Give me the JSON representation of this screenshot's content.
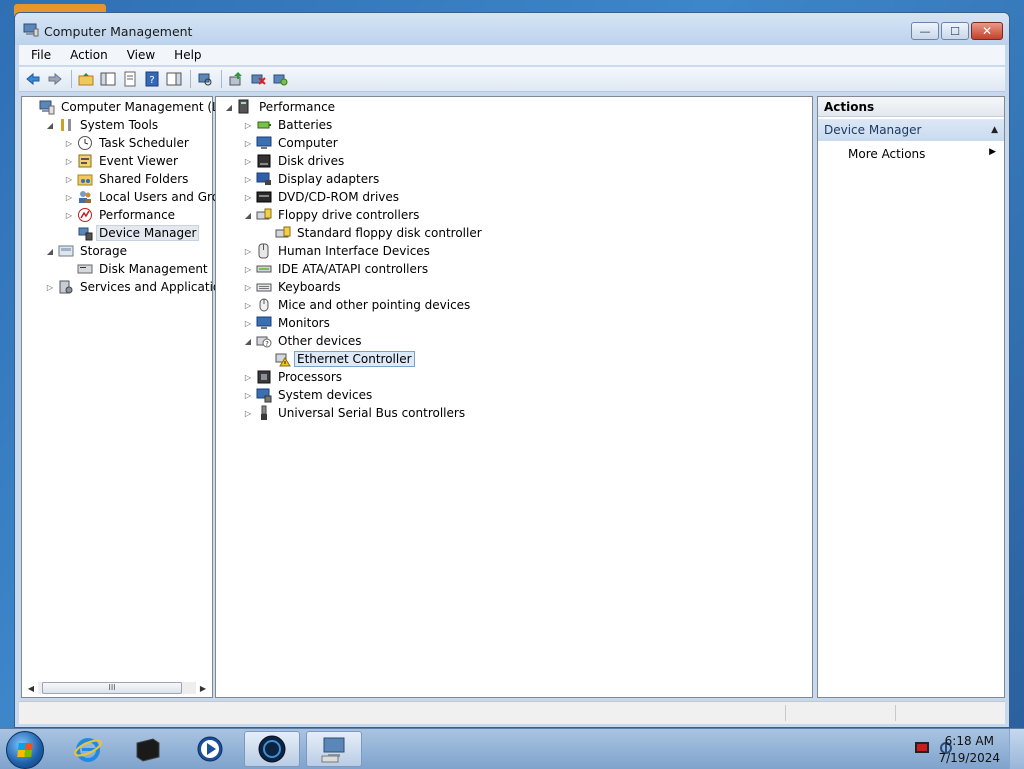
{
  "window": {
    "title": "Computer Management"
  },
  "caption": {
    "minimize": "—",
    "maximize": "☐",
    "close": "✕"
  },
  "menu": [
    "File",
    "Action",
    "View",
    "Help"
  ],
  "left_tree": [
    {
      "label": "Computer Management (Local",
      "icon": "computer-management-icon",
      "level": 0,
      "expander": "none"
    },
    {
      "label": "System Tools",
      "icon": "tools-icon",
      "level": 1,
      "expander": "expanded"
    },
    {
      "label": "Task Scheduler",
      "icon": "clock-icon",
      "level": 2,
      "expander": "collapsed"
    },
    {
      "label": "Event Viewer",
      "icon": "event-viewer-icon",
      "level": 2,
      "expander": "collapsed"
    },
    {
      "label": "Shared Folders",
      "icon": "shared-folder-icon",
      "level": 2,
      "expander": "collapsed"
    },
    {
      "label": "Local Users and Groups",
      "icon": "users-icon",
      "level": 2,
      "expander": "collapsed"
    },
    {
      "label": "Performance",
      "icon": "performance-icon",
      "level": 2,
      "expander": "collapsed"
    },
    {
      "label": "Device Manager",
      "icon": "device-manager-icon",
      "level": 2,
      "expander": "none",
      "selected": true
    },
    {
      "label": "Storage",
      "icon": "storage-icon",
      "level": 1,
      "expander": "expanded"
    },
    {
      "label": "Disk Management",
      "icon": "disk-icon",
      "level": 2,
      "expander": "none"
    },
    {
      "label": "Services and Applications",
      "icon": "services-icon",
      "level": 1,
      "expander": "collapsed"
    }
  ],
  "device_tree": [
    {
      "label": "Performance",
      "icon": "computer-icon",
      "level": 0,
      "expander": "expanded"
    },
    {
      "label": "Batteries",
      "icon": "battery-icon",
      "level": 1,
      "expander": "collapsed"
    },
    {
      "label": "Computer",
      "icon": "monitor-icon",
      "level": 1,
      "expander": "collapsed"
    },
    {
      "label": "Disk drives",
      "icon": "disk-drive-icon",
      "level": 1,
      "expander": "collapsed"
    },
    {
      "label": "Display adapters",
      "icon": "display-adapter-icon",
      "level": 1,
      "expander": "collapsed"
    },
    {
      "label": "DVD/CD-ROM drives",
      "icon": "dvd-icon",
      "level": 1,
      "expander": "collapsed"
    },
    {
      "label": "Floppy drive controllers",
      "icon": "floppy-controller-icon",
      "level": 1,
      "expander": "expanded"
    },
    {
      "label": "Standard floppy disk controller",
      "icon": "floppy-controller-icon",
      "level": 2,
      "expander": "none"
    },
    {
      "label": "Human Interface Devices",
      "icon": "hid-icon",
      "level": 1,
      "expander": "collapsed"
    },
    {
      "label": "IDE ATA/ATAPI controllers",
      "icon": "ide-icon",
      "level": 1,
      "expander": "collapsed"
    },
    {
      "label": "Keyboards",
      "icon": "keyboard-icon",
      "level": 1,
      "expander": "collapsed"
    },
    {
      "label": "Mice and other pointing devices",
      "icon": "mouse-icon",
      "level": 1,
      "expander": "collapsed"
    },
    {
      "label": "Monitors",
      "icon": "monitor-icon",
      "level": 1,
      "expander": "collapsed"
    },
    {
      "label": "Other devices",
      "icon": "unknown-device-icon",
      "level": 1,
      "expander": "expanded"
    },
    {
      "label": "Ethernet Controller",
      "icon": "warning-device-icon",
      "level": 2,
      "expander": "none",
      "highlight": true
    },
    {
      "label": "Processors",
      "icon": "processor-icon",
      "level": 1,
      "expander": "collapsed"
    },
    {
      "label": "System devices",
      "icon": "system-devices-icon",
      "level": 1,
      "expander": "collapsed"
    },
    {
      "label": "Universal Serial Bus controllers",
      "icon": "usb-icon",
      "level": 1,
      "expander": "collapsed"
    }
  ],
  "actions": {
    "header": "Actions",
    "section": "Device Manager",
    "more_actions": "More Actions"
  },
  "taskbar": {
    "time": "6:18 AM",
    "date": "7/19/2024"
  }
}
